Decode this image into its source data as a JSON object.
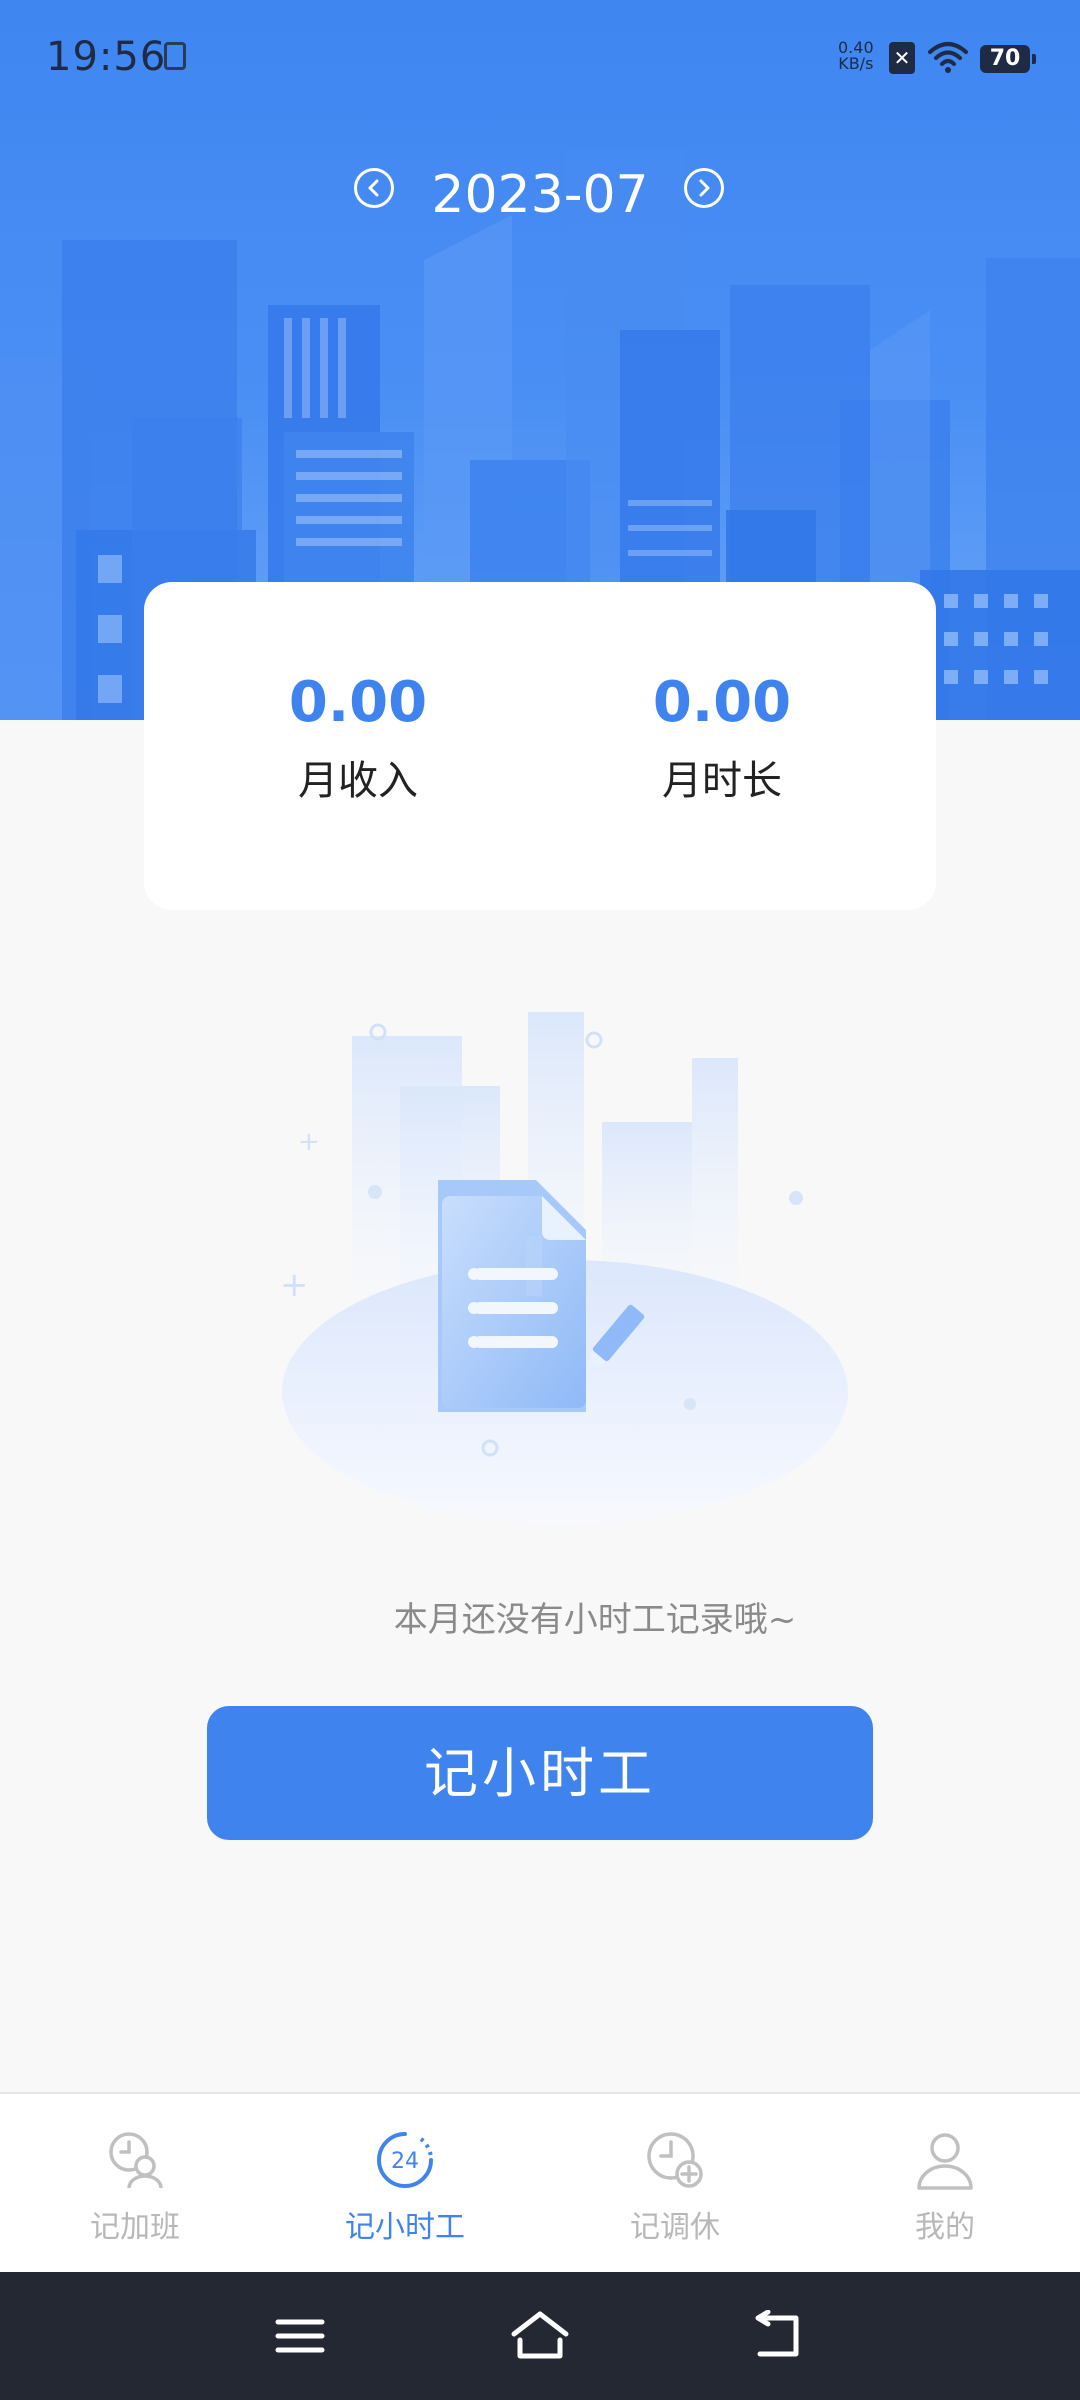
{
  "status_bar": {
    "time": "19:56",
    "net_speed_value": "0.40",
    "net_speed_unit": "KB/s",
    "x_badge": "✕",
    "battery_level": "70"
  },
  "header": {
    "month": "2023-07",
    "prev_icon": "chevron-left-circle-icon",
    "next_icon": "chevron-right-circle-icon"
  },
  "summary": {
    "income_value": "0.00",
    "income_label": "月收入",
    "hours_value": "0.00",
    "hours_label": "月时长"
  },
  "empty_state": {
    "illustration": "empty-document-icon",
    "message": "本月还没有小时工记录哦~"
  },
  "cta": {
    "label": "记小时工"
  },
  "tabs": [
    {
      "label": "记加班",
      "icon": "clock-person-icon",
      "active": false
    },
    {
      "label": "记小时工",
      "icon": "24-hour-icon",
      "badge": "24",
      "active": true
    },
    {
      "label": "记调休",
      "icon": "clock-plus-icon",
      "active": false
    },
    {
      "label": "我的",
      "icon": "person-icon",
      "active": false
    }
  ],
  "colors": {
    "primary": "#3f84ee",
    "inactive": "#b8b8b8",
    "system_nav": "#232833"
  }
}
